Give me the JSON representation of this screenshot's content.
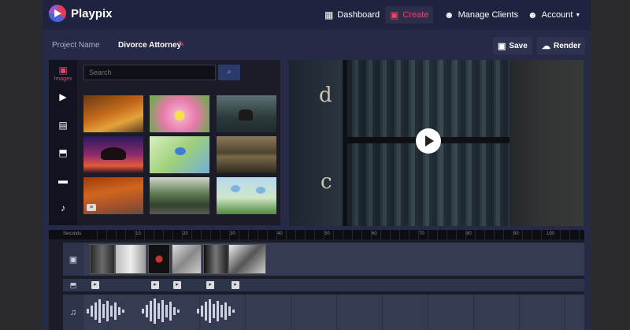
{
  "app": {
    "name": "Playpix"
  },
  "nav": {
    "dashboard": "Dashboard",
    "create": "Create",
    "manage_clients": "Manage Clients",
    "account": "Account"
  },
  "project": {
    "label": "Project Name",
    "name": "Divorce Attorney",
    "save": "Save",
    "render": "Render"
  },
  "tools": {
    "images_label": "Images",
    "items": [
      "images-icon",
      "video-icon",
      "collage-icon",
      "upload-icon",
      "folder-icon",
      "microphone-icon"
    ]
  },
  "search": {
    "placeholder": "Search"
  },
  "media": {
    "thumbnails": [
      "autumn forest path",
      "pink flower",
      "elephant in forest",
      "tree at sunset",
      "bird on blossom branch",
      "mountain lake",
      "autumn road",
      "forest road",
      "butterflies on flowers"
    ]
  },
  "timeline": {
    "ruler_label": "Seconds",
    "ticks": [
      "5",
      "10",
      "15",
      "20",
      "25",
      "30",
      "35",
      "40",
      "45",
      "50",
      "55",
      "60",
      "65",
      "70",
      "75",
      "80",
      "85",
      "90",
      "95",
      "100"
    ]
  },
  "colors": {
    "accent": "#e2486a",
    "background": "#262a47",
    "topbar": "#1f2340"
  }
}
